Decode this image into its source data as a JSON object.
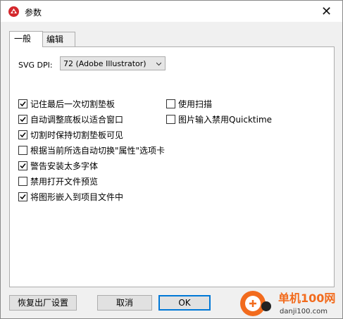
{
  "window": {
    "title": "参数",
    "close_glyph": "✕"
  },
  "tabs": [
    {
      "label": "一般",
      "active": true
    },
    {
      "label": "编辑",
      "active": false
    }
  ],
  "svg_dpi": {
    "label": "SVG DPI:",
    "selected": "72 (Adobe Illustrator)"
  },
  "options_left": [
    {
      "label": "记住最后一次切割垫板",
      "checked": true
    },
    {
      "label": "自动调整底板以适合窗口",
      "checked": true
    },
    {
      "label": "切割时保持切割垫板可见",
      "checked": true
    },
    {
      "label": "根据当前所选自动切换\"属性\"选项卡",
      "checked": false
    },
    {
      "label": "警告安装太多字体",
      "checked": true
    },
    {
      "label": "禁用打开文件预览",
      "checked": false
    },
    {
      "label": "将图形嵌入到项目文件中",
      "checked": true
    }
  ],
  "options_right": [
    {
      "label": "使用扫描",
      "checked": false
    },
    {
      "label": "图片输入禁用Quicktime",
      "checked": false
    }
  ],
  "buttons": {
    "reset": "恢复出厂设置",
    "cancel": "取消",
    "ok": "OK"
  },
  "watermark": {
    "text": "单机100网",
    "url": "danji100.com"
  },
  "colors": {
    "accent": "#0078d7",
    "watermark_orange": "#f26b1d"
  }
}
